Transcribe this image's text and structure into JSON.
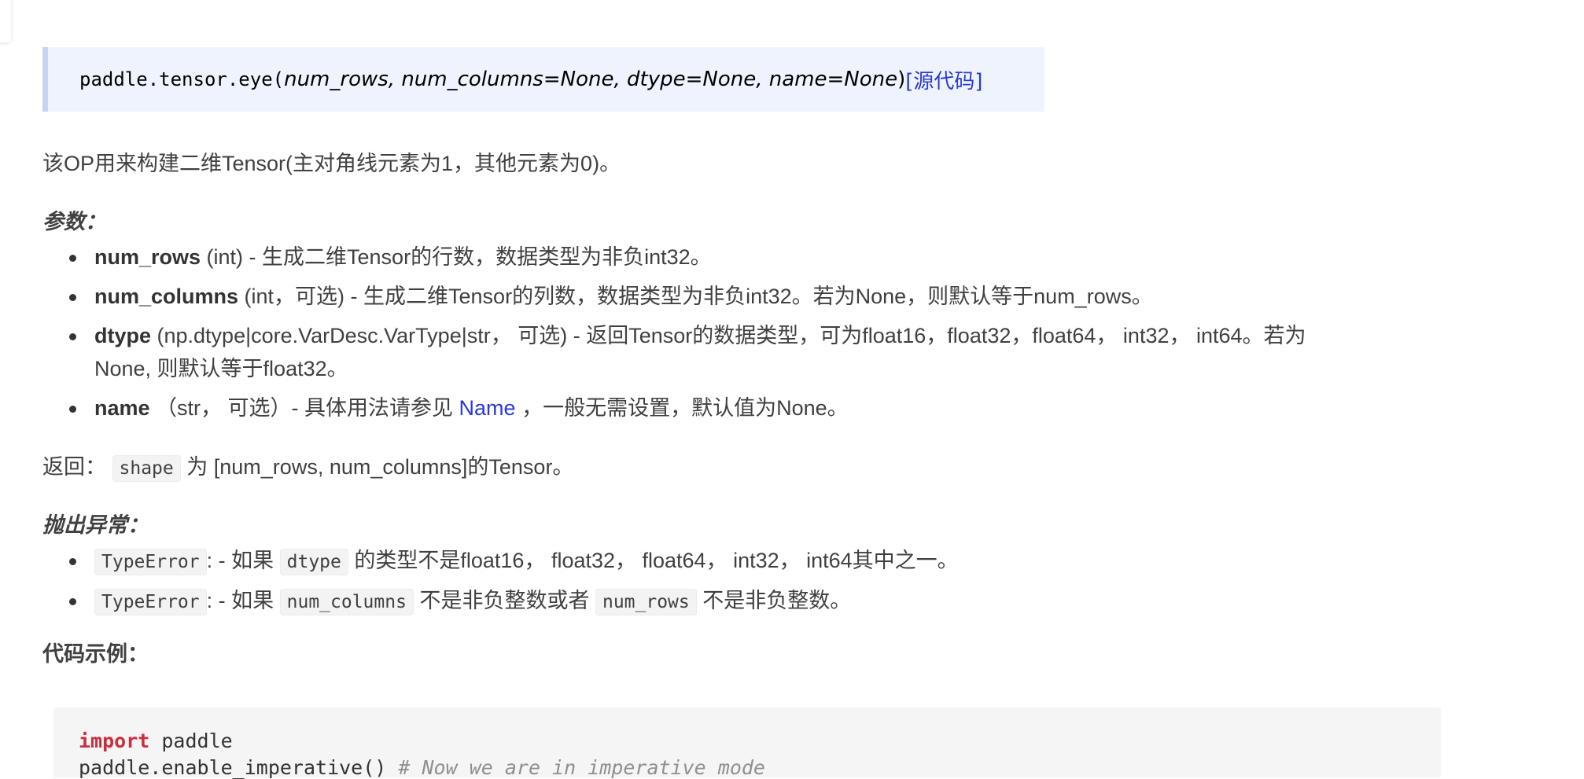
{
  "signature": {
    "func_name": "paddle.tensor.eye(",
    "params": "num_rows, num_columns=None, dtype=None, name=None",
    "close_paren": ")",
    "source_link": "[源代码]"
  },
  "description": "该OP用来构建二维Tensor(主对角线元素为1，其他元素为0)。",
  "params_heading": "参数：",
  "params": [
    {
      "name": "num_rows",
      "desc": " (int) - 生成二维Tensor的行数，数据类型为非负int32。"
    },
    {
      "name": "num_columns",
      "desc": " (int，可选) - 生成二维Tensor的列数，数据类型为非负int32。若为None，则默认等于num_rows。"
    },
    {
      "name": "dtype",
      "desc": " (np.dtype|core.VarDesc.VarType|str， 可选) - 返回Tensor的数据类型，可为float16，float32，float64， int32， int64。若为",
      "desc_line2": "None, 则默认等于float32。"
    },
    {
      "name": "name",
      "desc_before": " （str， 可选）- 具体用法请参见 ",
      "link": "Name",
      "desc_after": " ，一般无需设置，默认值为None。"
    }
  ],
  "returns": {
    "label": "返回：",
    "code": "shape",
    "text": " 为 [num_rows, num_columns]的Tensor。"
  },
  "raises_heading": "抛出异常：",
  "raises": [
    {
      "error": "TypeError",
      "mid": ": - 如果 ",
      "code": "dtype",
      "text": " 的类型不是float16， float32， float64， int32， int64其中之一。"
    },
    {
      "error": "TypeError",
      "mid": ": - 如果 ",
      "code": "num_columns",
      "text": " 不是非负整数或者 ",
      "code2": "num_rows",
      "text2": " 不是非负整数。"
    }
  ],
  "example_heading": "代码示例：",
  "code_example": {
    "line1_keyword": "import",
    "line1_rest": " paddle",
    "line2_code": "paddle.enable_imperative()",
    "line2_comment": "  # Now we are in imperative mode"
  }
}
